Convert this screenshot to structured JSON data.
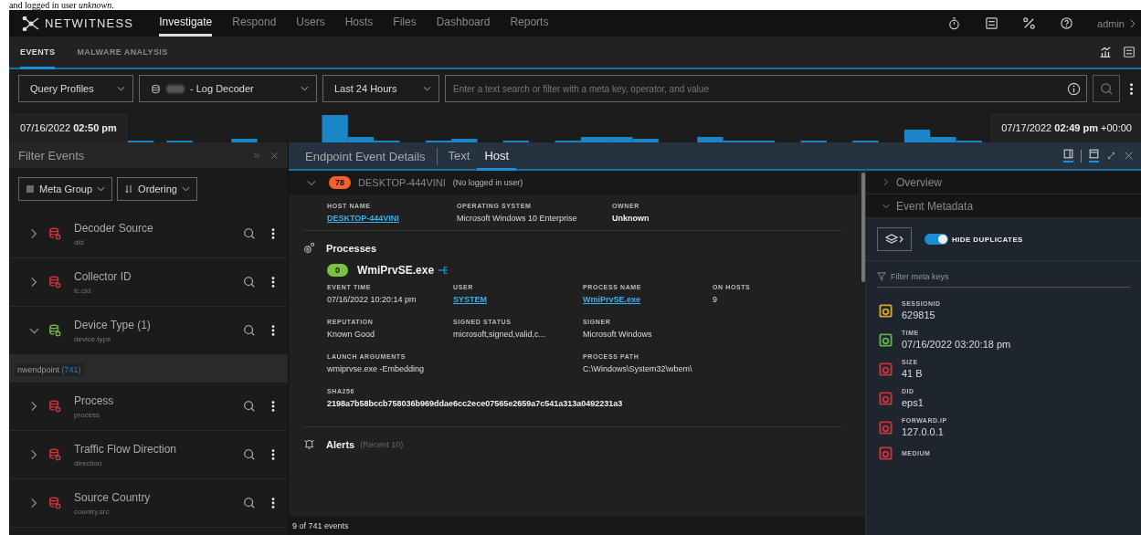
{
  "doc_text": "and logged in user *unknown*.",
  "brand": "NETWITNESS",
  "nav": [
    {
      "label": "Investigate",
      "selected": true
    },
    {
      "label": "Respond",
      "selected": false
    },
    {
      "label": "Users",
      "selected": false
    },
    {
      "label": "Hosts",
      "selected": false
    },
    {
      "label": "Files",
      "selected": false
    },
    {
      "label": "Dashboard",
      "selected": false
    },
    {
      "label": "Reports",
      "selected": false
    }
  ],
  "user": "admin",
  "subtabs": [
    {
      "label": "EVENTS",
      "selected": true
    },
    {
      "label": "MALWARE ANALYSIS",
      "selected": false
    }
  ],
  "query": {
    "profiles": "Query Profiles",
    "service": "- Log Decoder",
    "range": "Last 24 Hours",
    "placeholder": "Enter a text search or filter with a meta key, operator, and value"
  },
  "timeline": {
    "start": "07/16/2022 **02:50 pm**",
    "end": "07/17/2022 **02:49 pm** +00:00"
  },
  "filter": {
    "title": "Filter Events",
    "meta_group": "Meta Group",
    "ordering": "Ordering",
    "items": [
      {
        "name": "Decoder Source",
        "key": "did",
        "expanded": false,
        "color": "#d0343a"
      },
      {
        "name": "Collector ID",
        "key": "lc.cid",
        "expanded": false,
        "color": "#d0343a"
      },
      {
        "name": "Device Type (1)",
        "key": "device.type",
        "expanded": true,
        "color": "#6fb644",
        "values": [
          {
            "value": "nwendpoint",
            "count": "(741)"
          }
        ]
      },
      {
        "name": "Process",
        "key": "process",
        "expanded": false,
        "color": "#d0343a"
      },
      {
        "name": "Traffic Flow Direction",
        "key": "direction",
        "expanded": false,
        "color": "#d0343a"
      },
      {
        "name": "Source Country",
        "key": "country.src",
        "expanded": false,
        "color": "#d0343a"
      }
    ]
  },
  "details": {
    "tabs": [
      {
        "label": "Endpoint Event Details",
        "selected": false
      },
      {
        "label": "Text",
        "selected": false
      },
      {
        "label": "Host",
        "selected": true
      }
    ],
    "host": {
      "score": "78",
      "name": "DESKTOP-444VINI",
      "user": "(No logged in user)",
      "fields": [
        {
          "label": "HOST NAME",
          "value": "DESKTOP-444VINI",
          "kind": "link"
        },
        {
          "label": "OPERATING SYSTEM",
          "value": "Microsoft Windows 10 Enterprise",
          "kind": "text"
        },
        {
          "label": "OWNER",
          "value": "Unknown",
          "kind": "bold"
        }
      ]
    },
    "processes": {
      "title": "Processes",
      "score": "0",
      "name": "WmiPrvSE.exe",
      "rows": [
        [
          {
            "label": "EVENT TIME",
            "value": "07/16/2022 10:20:14 pm",
            "kind": "text"
          },
          {
            "label": "USER",
            "value": "SYSTEM",
            "kind": "link"
          },
          {
            "label": "PROCESS NAME",
            "value": "WmiPrvSE.exe",
            "kind": "link"
          },
          {
            "label": "ON HOSTS",
            "value": "9",
            "kind": "text"
          }
        ],
        [
          {
            "label": "REPUTATION",
            "value": "Known Good",
            "kind": "text"
          },
          {
            "label": "SIGNED STATUS",
            "value": "microsoft,signed,valid,c...",
            "kind": "text"
          },
          {
            "label": "SIGNER",
            "value": "Microsoft Windows",
            "kind": "text"
          }
        ],
        [
          {
            "label": "LAUNCH ARGUMENTS",
            "value": "wmiprvse.exe -Embedding",
            "kind": "text"
          },
          "",
          {
            "label": "PROCESS PATH",
            "value": "C:\\Windows\\System32\\wbem\\",
            "kind": "text"
          }
        ],
        [
          {
            "label": "SHA256",
            "value": "2198a7b58bccb758036b969ddae6cc2ece07565e2659a7c541a313a0492231a3",
            "kind": "bold"
          }
        ]
      ]
    },
    "alerts": {
      "title": "Alerts",
      "note": "(Recent 10)"
    },
    "status": "9 of 741 events"
  },
  "meta_panel": {
    "sections": [
      {
        "label": "Overview",
        "expanded": false
      },
      {
        "label": "Event Metadata",
        "expanded": true
      }
    ],
    "hide_duplicates": {
      "label": "HIDE DUPLICATES",
      "on": true
    },
    "filter_placeholder": "Filter meta keys",
    "items": [
      {
        "key": "SESSIONID",
        "value": "629815",
        "color": "#d9a520"
      },
      {
        "key": "TIME",
        "value": "07/16/2022 03:20:18 pm",
        "color": "#5fb14a"
      },
      {
        "key": "SIZE",
        "value": "41 B",
        "color": "#d0343a"
      },
      {
        "key": "DID",
        "value": "eps1",
        "color": "#d0343a"
      },
      {
        "key": "FORWARD.IP",
        "value": "127.0.0.1",
        "color": "#d0343a"
      },
      {
        "key": "MEDIUM",
        "color": "#d0343a"
      }
    ]
  }
}
